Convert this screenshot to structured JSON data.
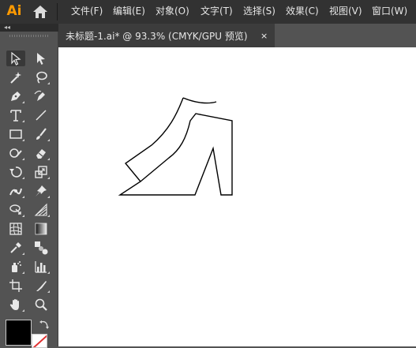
{
  "app": {
    "logo_text": "Ai"
  },
  "menu": [
    "文件(F)",
    "编辑(E)",
    "对象(O)",
    "文字(T)",
    "选择(S)",
    "效果(C)",
    "视图(V)",
    "窗口(W)"
  ],
  "tools_panel": {
    "collapse_glyph": "◂◂"
  },
  "document": {
    "tab_title": "未标题-1.ai* @ 93.3% (CMYK/GPU 预览)",
    "close_glyph": "×"
  },
  "colors": {
    "accent": "#ff9a00",
    "menubar": "#323232",
    "panel": "#535353",
    "canvas": "#ffffff",
    "fill": "#000000",
    "stroke_none_slash": "#e03030"
  },
  "tools": [
    "selection-tool",
    "direct-selection-tool",
    "magic-wand-tool",
    "lasso-tool",
    "pen-tool",
    "curvature-tool",
    "type-tool",
    "line-segment-tool",
    "rectangle-tool",
    "paintbrush-tool",
    "shaper-tool",
    "eraser-tool",
    "rotate-tool",
    "scale-tool",
    "width-tool",
    "puppet-warp-tool",
    "shape-builder-tool",
    "perspective-grid-tool",
    "mesh-tool",
    "gradient-tool",
    "eyedropper-tool",
    "blend-tool",
    "symbol-sprayer-tool",
    "column-graph-tool",
    "artboard-tool",
    "slice-tool",
    "hand-tool",
    "zoom-tool"
  ]
}
